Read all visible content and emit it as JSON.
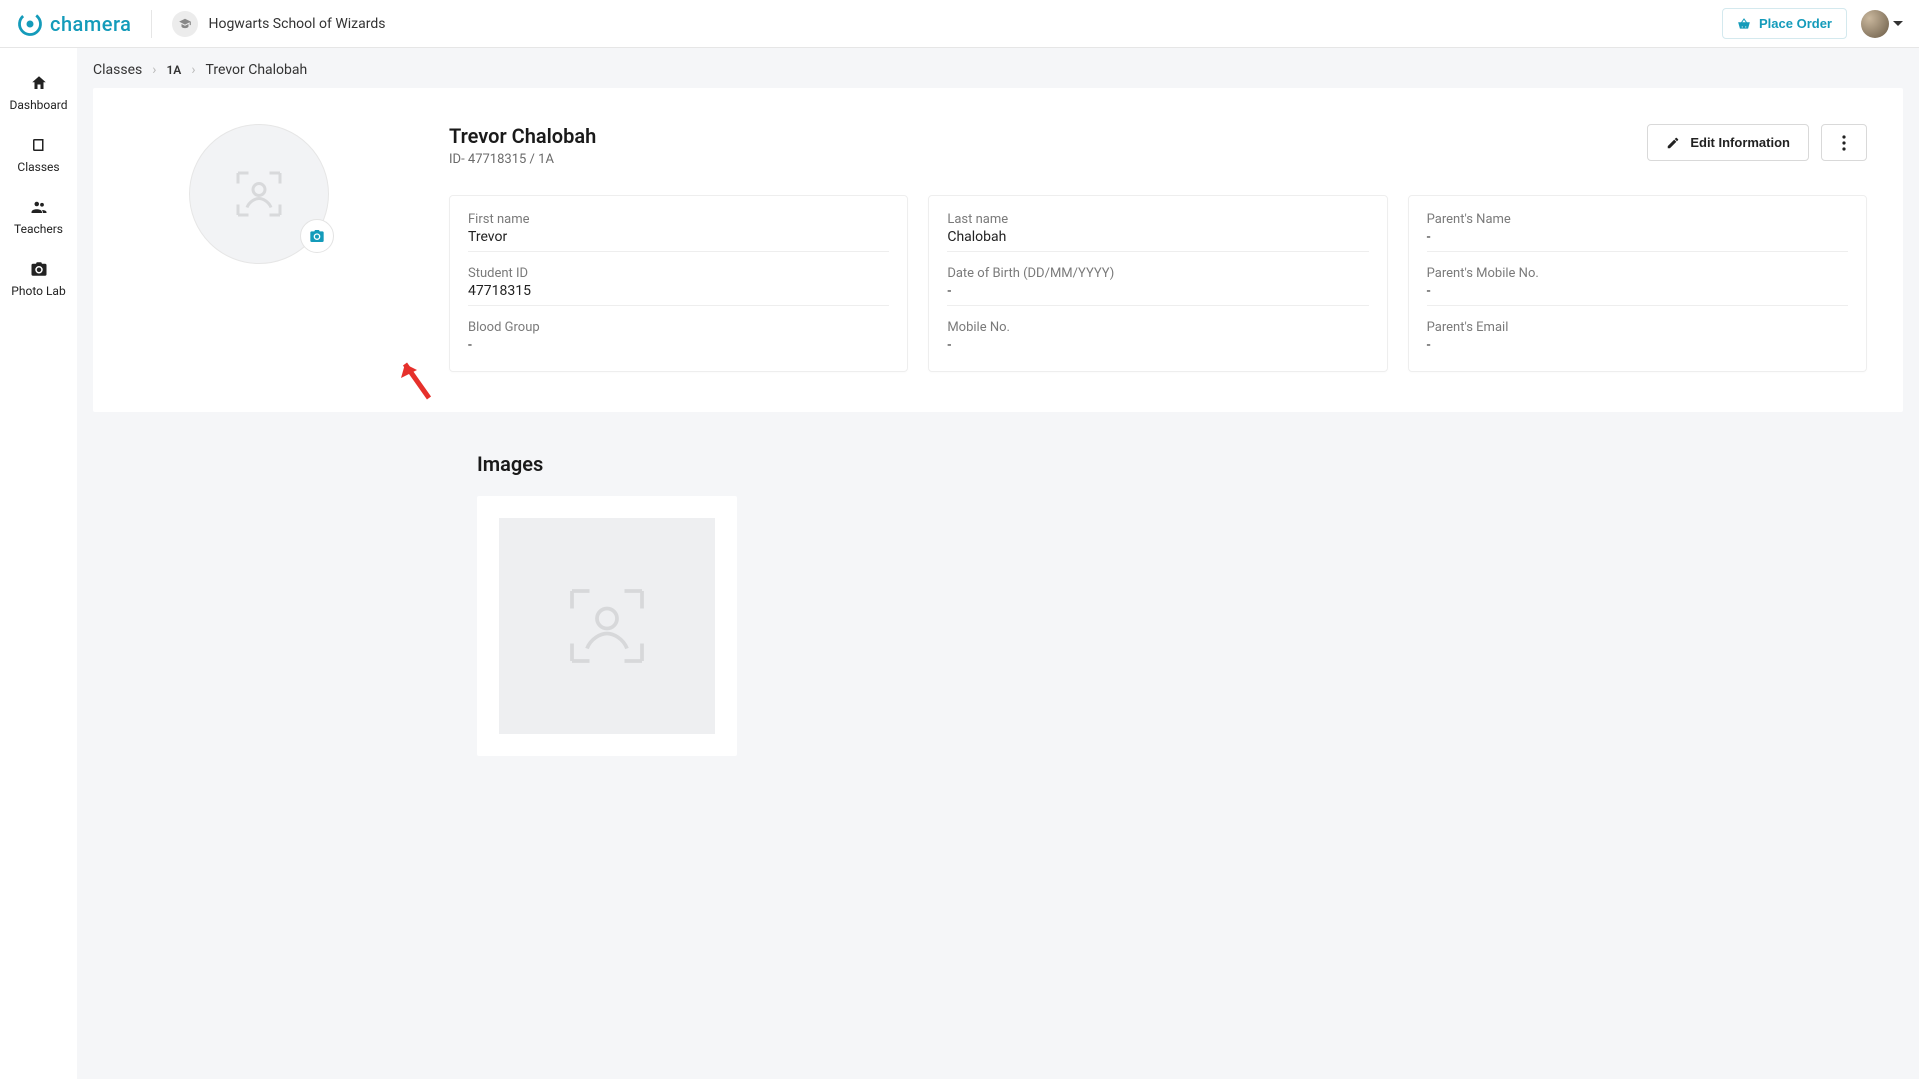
{
  "header": {
    "brand": "chamera",
    "school_name": "Hogwarts School of Wizards",
    "place_order_label": "Place Order"
  },
  "sidebar": {
    "items": [
      {
        "label": "Dashboard"
      },
      {
        "label": "Classes"
      },
      {
        "label": "Teachers"
      },
      {
        "label": "Photo Lab"
      }
    ]
  },
  "breadcrumb": {
    "root": "Classes",
    "section": "1A",
    "current": "Trevor Chalobah"
  },
  "student": {
    "name": "Trevor Chalobah",
    "sub": "ID- 47718315 / 1A",
    "edit_label": "Edit Information",
    "columns": [
      [
        {
          "label": "First name",
          "value": "Trevor"
        },
        {
          "label": "Student ID",
          "value": "47718315"
        },
        {
          "label": "Blood Group",
          "value": "-"
        }
      ],
      [
        {
          "label": "Last name",
          "value": "Chalobah"
        },
        {
          "label": "Date of Birth (DD/MM/YYYY)",
          "value": "-"
        },
        {
          "label": "Mobile No.",
          "value": "-"
        }
      ],
      [
        {
          "label": "Parent's Name",
          "value": "-"
        },
        {
          "label": "Parent's Mobile No.",
          "value": "-"
        },
        {
          "label": "Parent's Email",
          "value": "-"
        }
      ]
    ]
  },
  "images_section": {
    "heading": "Images"
  }
}
